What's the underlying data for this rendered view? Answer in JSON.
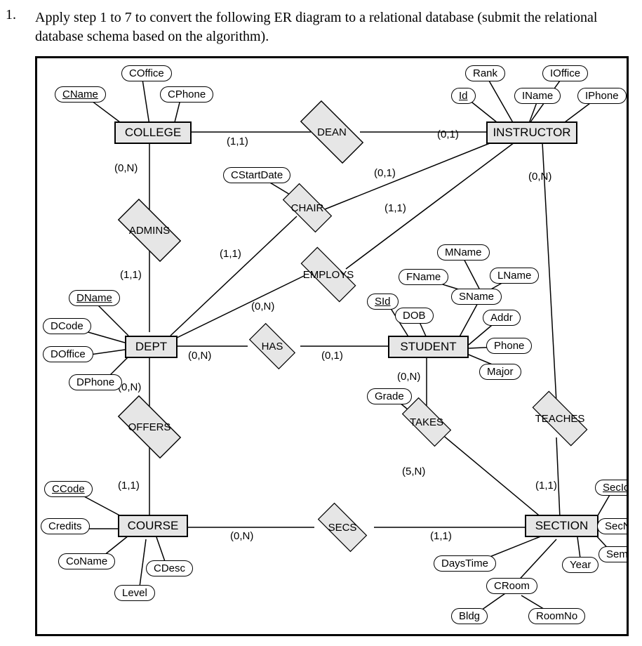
{
  "question_number": "1.",
  "question_text": "Apply step 1 to 7 to convert the following ER diagram to a relational database (submit the relational database schema based on the algorithm).",
  "entities": {
    "college": "COLLEGE",
    "instructor": "INSTRUCTOR",
    "dept": "DEPT",
    "student": "STUDENT",
    "course": "COURSE",
    "section": "SECTION"
  },
  "relationships": {
    "dean": "DEAN",
    "admins": "ADMINS",
    "chair": "CHAIR",
    "employs": "EMPLOYS",
    "has": "HAS",
    "offers": "OFFERS",
    "takes": "TAKES",
    "teaches": "TEACHES",
    "secs": "SECS"
  },
  "attributes": {
    "coffice": "COffice",
    "cname": "CName",
    "cphone": "CPhone",
    "rank": "Rank",
    "ioffice": "IOffice",
    "id": "Id",
    "iname": "IName",
    "iphone": "IPhone",
    "cstartdate": "CStartDate",
    "dname": "DName",
    "dcode": "DCode",
    "doffice": "DOffice",
    "dphone": "DPhone",
    "mname": "MName",
    "fname": "FName",
    "lname": "LName",
    "sid": "SId",
    "sname": "SName",
    "dob": "DOB",
    "addr": "Addr",
    "phone": "Phone",
    "major": "Major",
    "grade": "Grade",
    "ccode": "CCode",
    "credits": "Credits",
    "coname": "CoName",
    "cdesc": "CDesc",
    "level": "Level",
    "secid": "SecId",
    "secno": "SecNo",
    "sem": "Sem",
    "year": "Year",
    "daystime": "DaysTime",
    "croom": "CRoom",
    "bldg": "Bldg",
    "roomno": "RoomNo"
  },
  "cardinalities": {
    "college_dean": "(1,1)",
    "instructor_dean": "(0,1)",
    "college_admins": "(0,N)",
    "dept_admins": "(1,1)",
    "dept_chair": "(1,1)",
    "instructor_chair": "(0,1)",
    "dept_employs": "(0,N)",
    "instructor_employs": "(1,1)",
    "dept_has": "(0,N)",
    "student_has": "(0,1)",
    "dept_offers": "(0,N)",
    "course_offers": "(1,1)",
    "student_takes": "(0,N)",
    "section_takes": "(5,N)",
    "instructor_teaches": "(0,N)",
    "section_teaches": "(1,1)",
    "course_secs": "(0,N)",
    "section_secs": "(1,1)"
  }
}
